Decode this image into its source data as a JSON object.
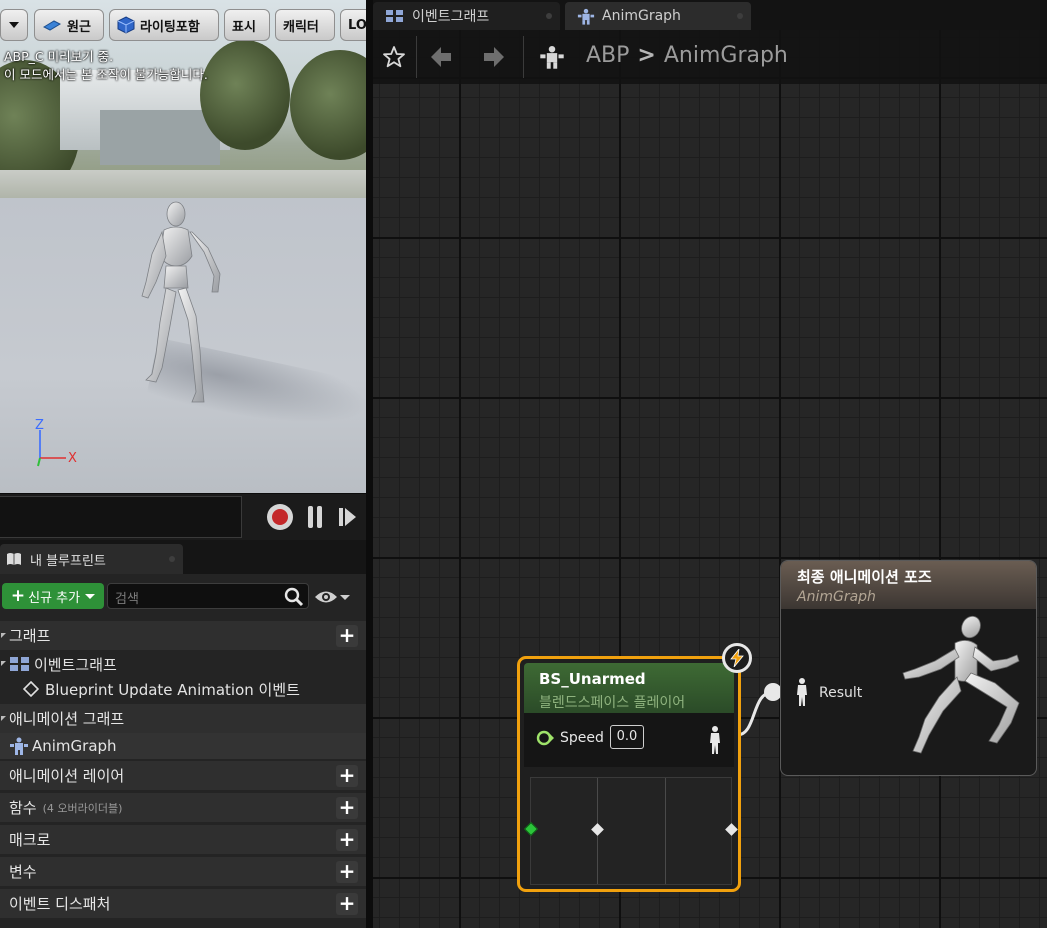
{
  "viewport": {
    "dropdown_label": "",
    "toolbar": {
      "perspective": "원근",
      "lighting": "라이팅포함",
      "show": "표시",
      "character": "캐릭터",
      "lod": "LO"
    },
    "info_line1": "ABP_C 미리보기 중.",
    "info_line2": "이 모드에서는 본 조작이 불가능합니다.",
    "axis": {
      "z": "Z",
      "x": "X"
    }
  },
  "my_blueprint": {
    "tab_label": "내 블루프린트",
    "new_button": "신규 추가",
    "search_placeholder": "검색",
    "graphs_header": "그래프",
    "event_graph": "이벤트그래프",
    "update_event": "Blueprint Update Animation 이벤트",
    "anim_graphs_header": "애니메이션 그래프",
    "anim_graph_item": "AnimGraph",
    "anim_layers": "애니메이션 레이어",
    "functions": "함수",
    "functions_sub": "(4 오버라이더블)",
    "macros": "매크로",
    "variables": "변수",
    "dispatchers": "이벤트 디스패처"
  },
  "graph_tabs": [
    {
      "label": "이벤트그래프"
    },
    {
      "label": "AnimGraph"
    }
  ],
  "breadcrumb": {
    "root": "ABP",
    "sep": ">",
    "current": "AnimGraph"
  },
  "node_blendspace": {
    "title": "BS_Unarmed",
    "subtitle": "블렌드스페이스 플레이어",
    "pin_label": "Speed",
    "pin_value": "0.0"
  },
  "node_output": {
    "title": "최종 애니메이션 포즈",
    "subtitle": "AnimGraph",
    "pin_label": "Result"
  },
  "colors": {
    "accent_orange": "#f1a10e",
    "node_green": "#3e6a34",
    "add_green": "#2e9138",
    "record_red": "#c4282a"
  }
}
